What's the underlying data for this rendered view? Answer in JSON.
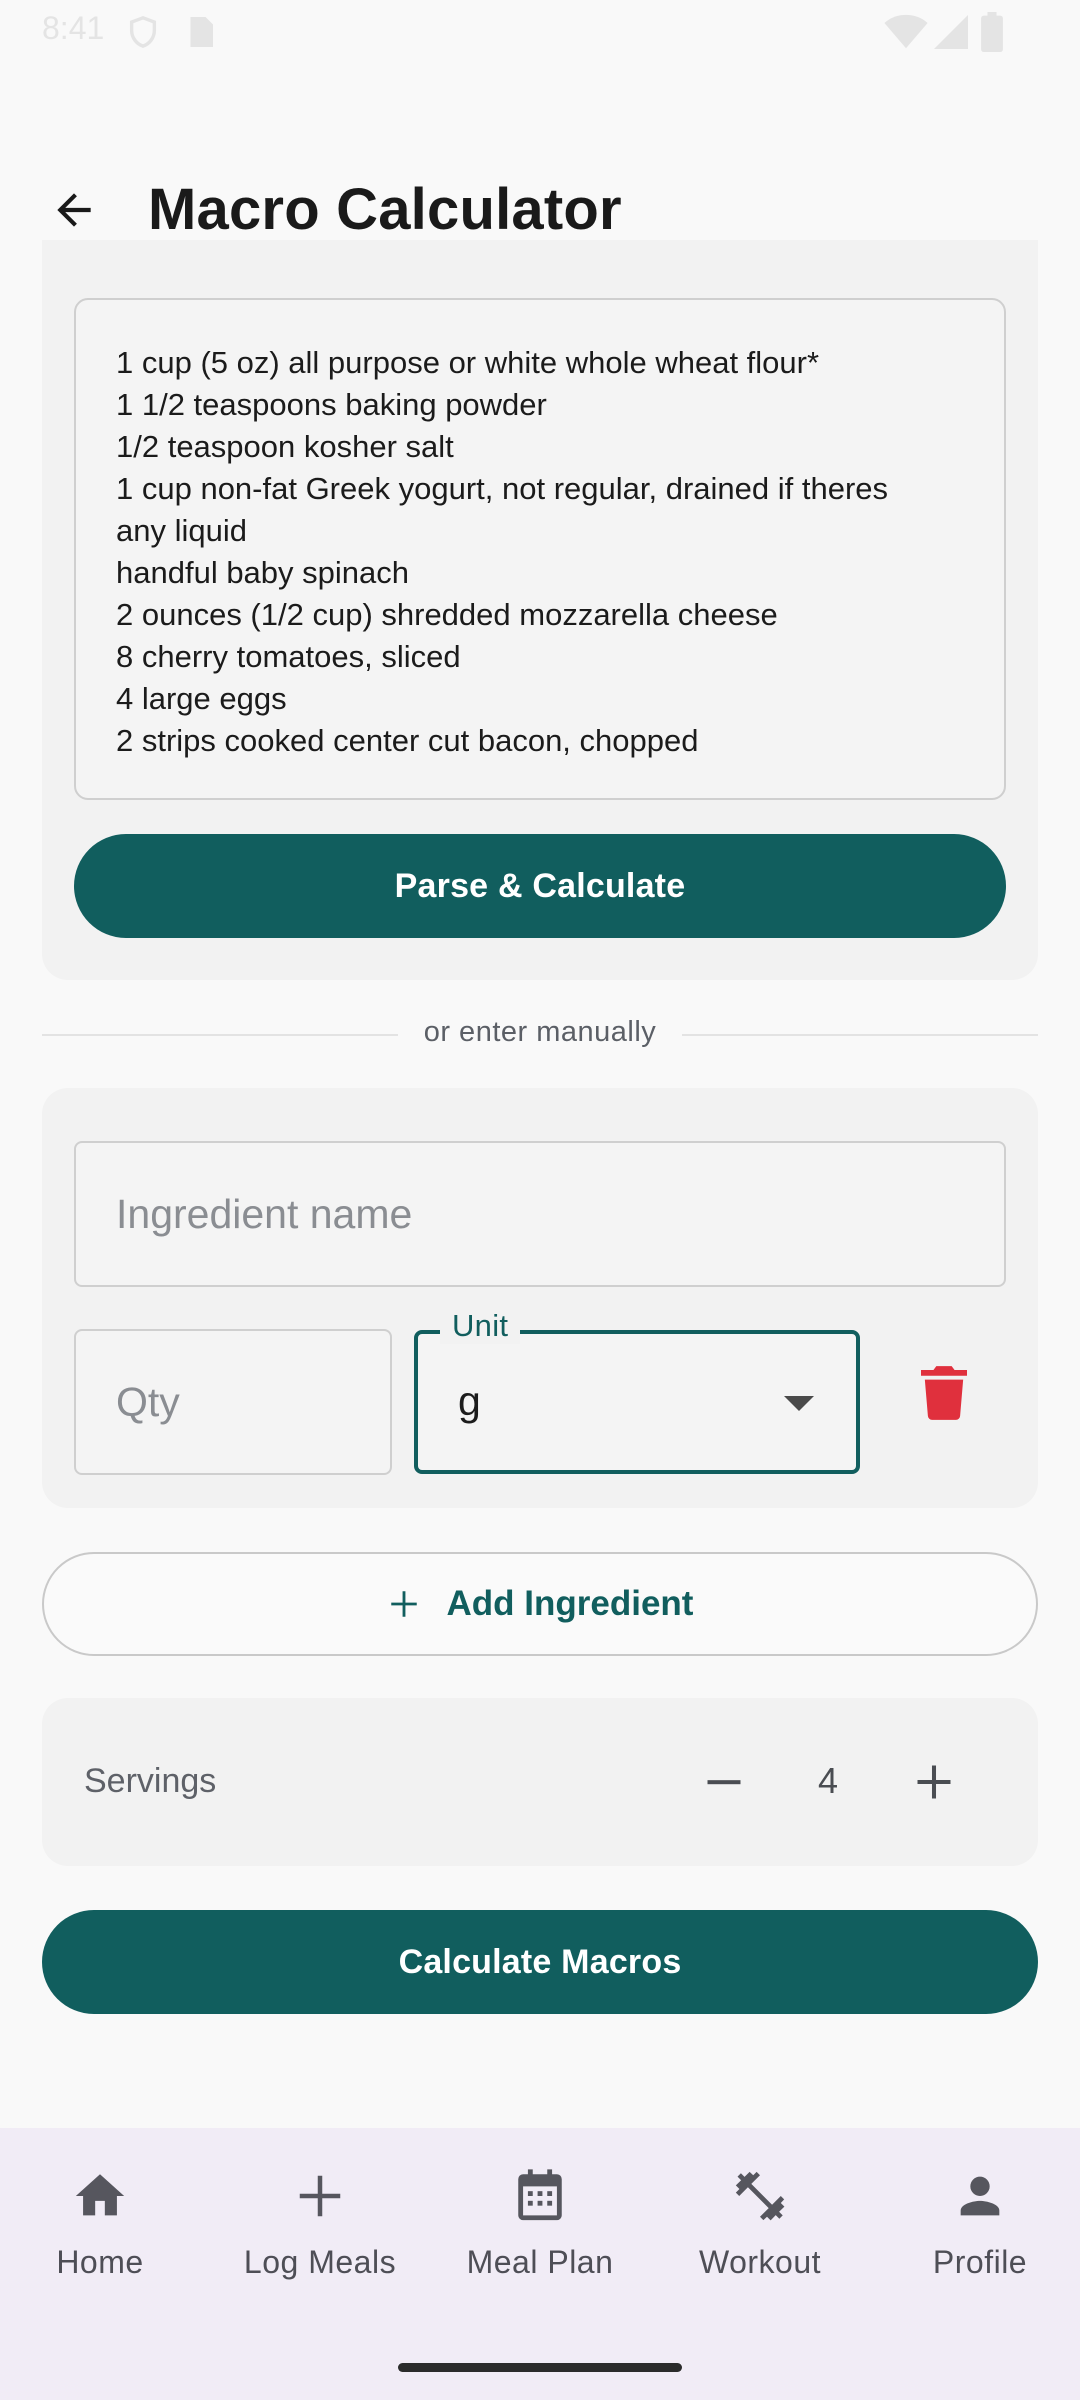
{
  "status_bar": {
    "time": "8:41"
  },
  "app_bar": {
    "title": "Macro Calculator",
    "back_icon": "arrow-left-icon"
  },
  "recipe": {
    "lines": [
      "1 cup (5 oz) all purpose or white whole wheat flour*",
      "1 1/2 teaspoons baking powder",
      "1/2 teaspoon kosher salt",
      "1 cup non-fat Greek yogurt, not regular, drained if theres",
      "any liquid",
      "handful baby spinach",
      "2 ounces (1/2 cup) shredded mozzarella cheese",
      "8 cherry tomatoes, sliced",
      "4 large eggs",
      "2 strips cooked center cut bacon, chopped"
    ],
    "parse_button": "Parse & Calculate"
  },
  "divider_text": "or enter manually",
  "manual": {
    "ingredient_placeholder": "Ingredient name",
    "qty_placeholder": "Qty",
    "unit_label": "Unit",
    "unit_value": "g",
    "delete_icon": "trash-icon"
  },
  "add_ingredient": "Add Ingredient",
  "servings": {
    "label": "Servings",
    "value": "4"
  },
  "calculate_button": "Calculate Macros",
  "nav": {
    "items": [
      {
        "label": "Home",
        "icon": "home-icon"
      },
      {
        "label": "Log Meals",
        "icon": "plus-icon"
      },
      {
        "label": "Meal Plan",
        "icon": "calendar-icon"
      },
      {
        "label": "Workout",
        "icon": "dumbbell-icon"
      },
      {
        "label": "Profile",
        "icon": "person-icon"
      }
    ]
  },
  "colors": {
    "primary": "#115e5e",
    "delete": "#e0303d",
    "nav_background": "#f1ecf6",
    "card_background": "#f2f2f2"
  }
}
